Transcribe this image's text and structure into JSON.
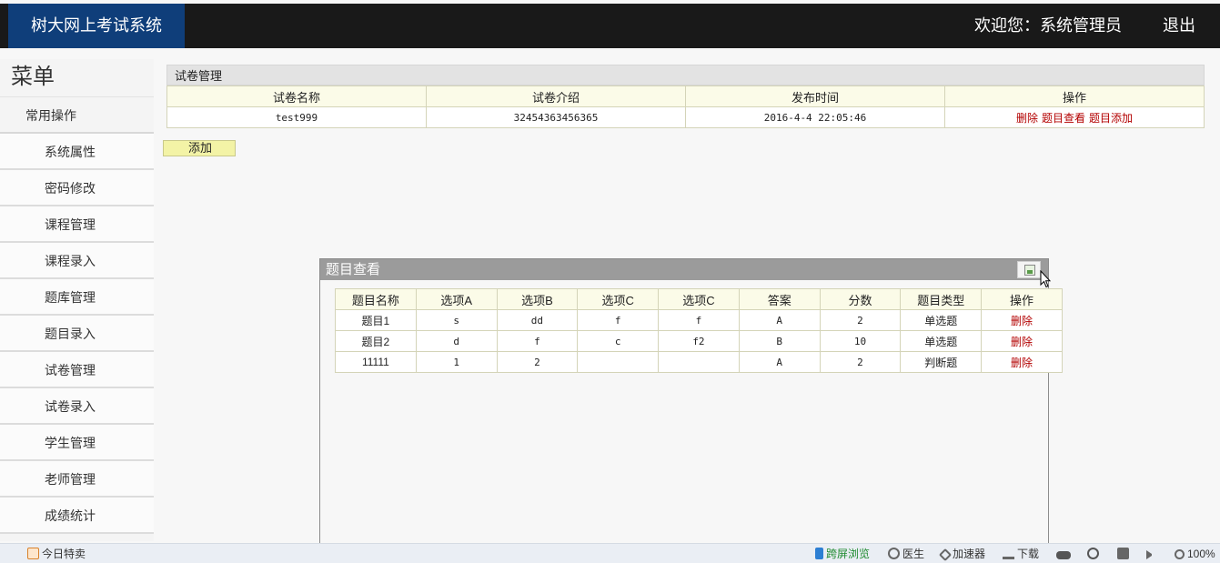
{
  "header": {
    "app_title": "树大网上考试系统",
    "welcome_text": "欢迎您：系统管理员",
    "logout_label": "退出"
  },
  "sidebar": {
    "title": "菜单",
    "group_label": "常用操作",
    "items": [
      {
        "label": "系统属性"
      },
      {
        "label": "密码修改"
      },
      {
        "label": "课程管理"
      },
      {
        "label": "课程录入"
      },
      {
        "label": "题库管理"
      },
      {
        "label": "题目录入"
      },
      {
        "label": "试卷管理"
      },
      {
        "label": "试卷录入"
      },
      {
        "label": "学生管理"
      },
      {
        "label": "老师管理"
      },
      {
        "label": "成绩统计"
      }
    ]
  },
  "paper_panel": {
    "title": "试卷管理",
    "columns": [
      "试卷名称",
      "试卷介绍",
      "发布时间",
      "操作"
    ],
    "rows": [
      {
        "name": "test999",
        "intro": "32454363456365",
        "publish_time": "2016-4-4 22:05:46",
        "actions": {
          "delete": "删除",
          "view_questions": "题目查看",
          "add_question": "题目添加"
        }
      }
    ],
    "add_button_label": "添加"
  },
  "question_dialog": {
    "title": "题目查看",
    "columns": [
      "题目名称",
      "选项A",
      "选项B",
      "选项C",
      "选项C",
      "答案",
      "分数",
      "题目类型",
      "操作"
    ],
    "rows": [
      {
        "name": "题目1",
        "a": "s",
        "b": "dd",
        "c": "f",
        "d": "f",
        "answer": "A",
        "score": "2",
        "type": "单选题",
        "action": "删除"
      },
      {
        "name": "题目2",
        "a": "d",
        "b": "f",
        "c": "c",
        "d": "f2",
        "answer": "B",
        "score": "10",
        "type": "单选题",
        "action": "删除"
      },
      {
        "name": "11111",
        "a": "1",
        "b": "2",
        "c": "",
        "d": "",
        "answer": "A",
        "score": "2",
        "type": "判断题",
        "action": "删除"
      }
    ]
  },
  "statusbar": {
    "deals_label": "今日特卖",
    "cross_screen_label": "跨屏浏览",
    "doctor_label": "医生",
    "accelerator_label": "加速器",
    "download_label": "下载",
    "zoom_label": "100%"
  },
  "colors": {
    "brand_bg": "#0f3e7a",
    "topbar_bg": "#191919",
    "link_red": "#b30000",
    "table_header_bg": "#fbfbe8",
    "add_button_bg": "#f3f3a6",
    "dialog_header_bg": "#9b9b9b"
  },
  "icons": [
    "close-image-icon",
    "mouse-cursor-icon",
    "gift-icon",
    "phone-icon",
    "doctor-icon",
    "rocket-icon",
    "download-icon",
    "ie-icon",
    "window-icon",
    "speaker-icon",
    "zoom-icon"
  ]
}
